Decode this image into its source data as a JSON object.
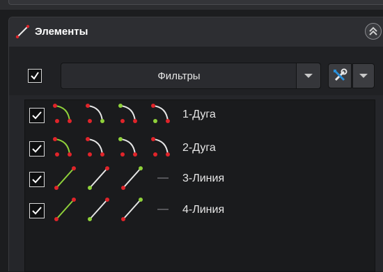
{
  "panel": {
    "title": "Элементы",
    "title_icon": "line-segment-icon",
    "collapse_icon": "double-chevron-up-icon"
  },
  "toolbar": {
    "select_all_checked": true,
    "filter_label": "Фильтры",
    "tool_icon": "wrench-screwdriver-icon"
  },
  "elements": [
    {
      "label": "1-Дуга",
      "checked": true,
      "kind": "arc"
    },
    {
      "label": "2-Дуга",
      "checked": true,
      "kind": "arc"
    },
    {
      "label": "3-Линия",
      "checked": true,
      "kind": "line"
    },
    {
      "label": "4-Линия",
      "checked": true,
      "kind": "line"
    }
  ],
  "colors": {
    "endpoint_red": "#e0242a",
    "endpoint_green": "#8fd13a",
    "segment_green": "#8fd13a",
    "segment_white": "#e6e6e6"
  }
}
